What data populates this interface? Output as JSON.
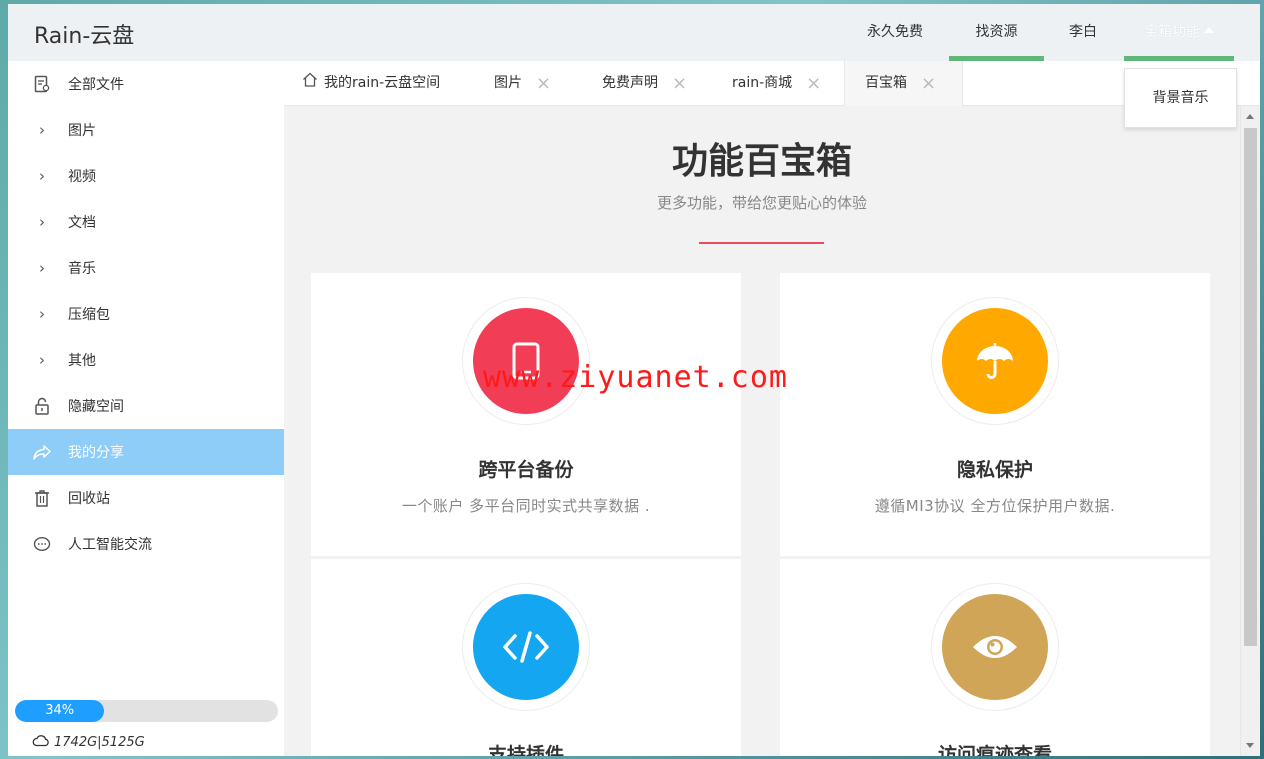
{
  "header": {
    "logo": "Rain-云盘",
    "nav": [
      {
        "label": "永久免费",
        "active": false
      },
      {
        "label": "找资源",
        "active": true
      },
      {
        "label": "李白",
        "active": false
      },
      {
        "label": "宝箱功能",
        "active": true
      }
    ],
    "dropdown_item": "背景音乐"
  },
  "sidebar": {
    "items": [
      {
        "label": "全部文件",
        "icon": "file-icon"
      },
      {
        "label": "图片",
        "icon": "chevron-right-icon"
      },
      {
        "label": "视频",
        "icon": "chevron-right-icon"
      },
      {
        "label": "文档",
        "icon": "chevron-right-icon"
      },
      {
        "label": "音乐",
        "icon": "chevron-right-icon"
      },
      {
        "label": "压缩包",
        "icon": "chevron-right-icon"
      },
      {
        "label": "其他",
        "icon": "chevron-right-icon"
      },
      {
        "label": "隐藏空间",
        "icon": "lock-icon"
      },
      {
        "label": "我的分享",
        "icon": "share-icon",
        "active": true
      },
      {
        "label": "回收站",
        "icon": "trash-icon"
      },
      {
        "label": "人工智能交流",
        "icon": "chat-icon"
      }
    ],
    "usage_percent": 34,
    "usage_label": "34%",
    "storage_label": "1742G|5125G"
  },
  "tabs": [
    {
      "label": "我的rain-云盘空间",
      "icon": "home-icon",
      "closable": false
    },
    {
      "label": "图片",
      "closable": true
    },
    {
      "label": "免费声明",
      "closable": true
    },
    {
      "label": "rain-商城",
      "closable": true
    },
    {
      "label": "百宝箱",
      "closable": true,
      "current": true
    }
  ],
  "main": {
    "title": "功能百宝箱",
    "subtitle": "更多功能，带给您更贴心的体验",
    "accent_color": "#e74c5a",
    "cards": [
      {
        "title": "跨平台备份",
        "desc": "一个账户 多平台同时实式共享数据 .",
        "icon": "tablet-icon",
        "color": "#f23d56"
      },
      {
        "title": "隐私保护",
        "desc": "遵循MI3协议 全方位保护用户数据.",
        "icon": "umbrella-icon",
        "color": "#ffa800"
      },
      {
        "title": "支持插件",
        "desc": "",
        "icon": "code-icon",
        "color": "#14a6f0"
      },
      {
        "title": "访问痕迹查看",
        "desc": "",
        "icon": "eye-icon",
        "color": "#d1a557"
      }
    ]
  },
  "watermark": "www.ziyuanet.com"
}
